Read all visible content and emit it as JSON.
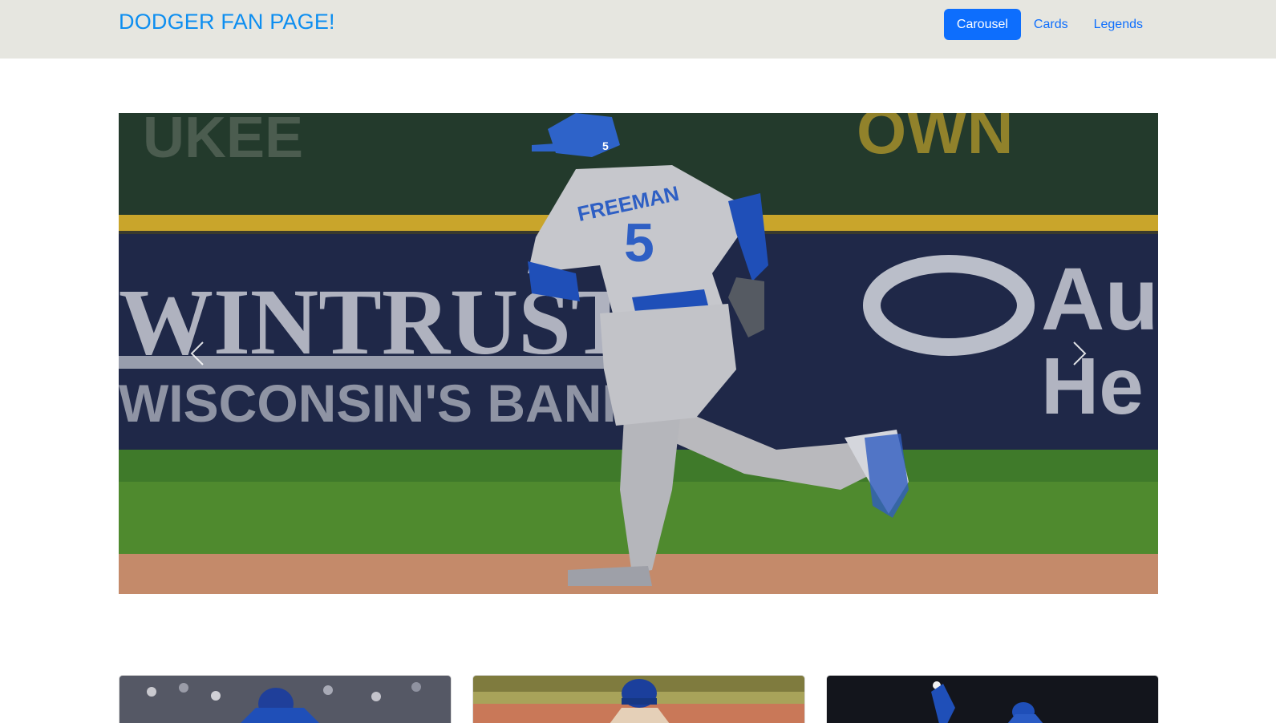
{
  "navbar": {
    "brand": "DODGER FAN PAGE!",
    "links": [
      {
        "label": "Carousel",
        "active": true
      },
      {
        "label": "Cards",
        "active": false
      },
      {
        "label": "Legends",
        "active": false
      }
    ]
  },
  "carousel": {
    "jersey_name": "FREEMAN",
    "jersey_number": "5",
    "helmet_number": "5",
    "sign_main": "WINTRUST",
    "sign_sub": "WISCONSIN'S BANK",
    "sign_top_left": "UKEE",
    "sign_top_right": "OWN",
    "sign_right_1": "Au",
    "sign_right_2": "He",
    "prev_icon": "chevron-left-icon",
    "next_icon": "chevron-right-icon"
  },
  "cards": [
    {
      "image": "dodger-fielder-crowd"
    },
    {
      "image": "dodger-player-cap"
    },
    {
      "image": "dodger-pitcher-night"
    }
  ],
  "colors": {
    "brand": "#0d8ef0",
    "accent": "#0d6efd",
    "navbar_bg": "#e6e6e0",
    "dodger_blue": "#1f4fb8"
  }
}
